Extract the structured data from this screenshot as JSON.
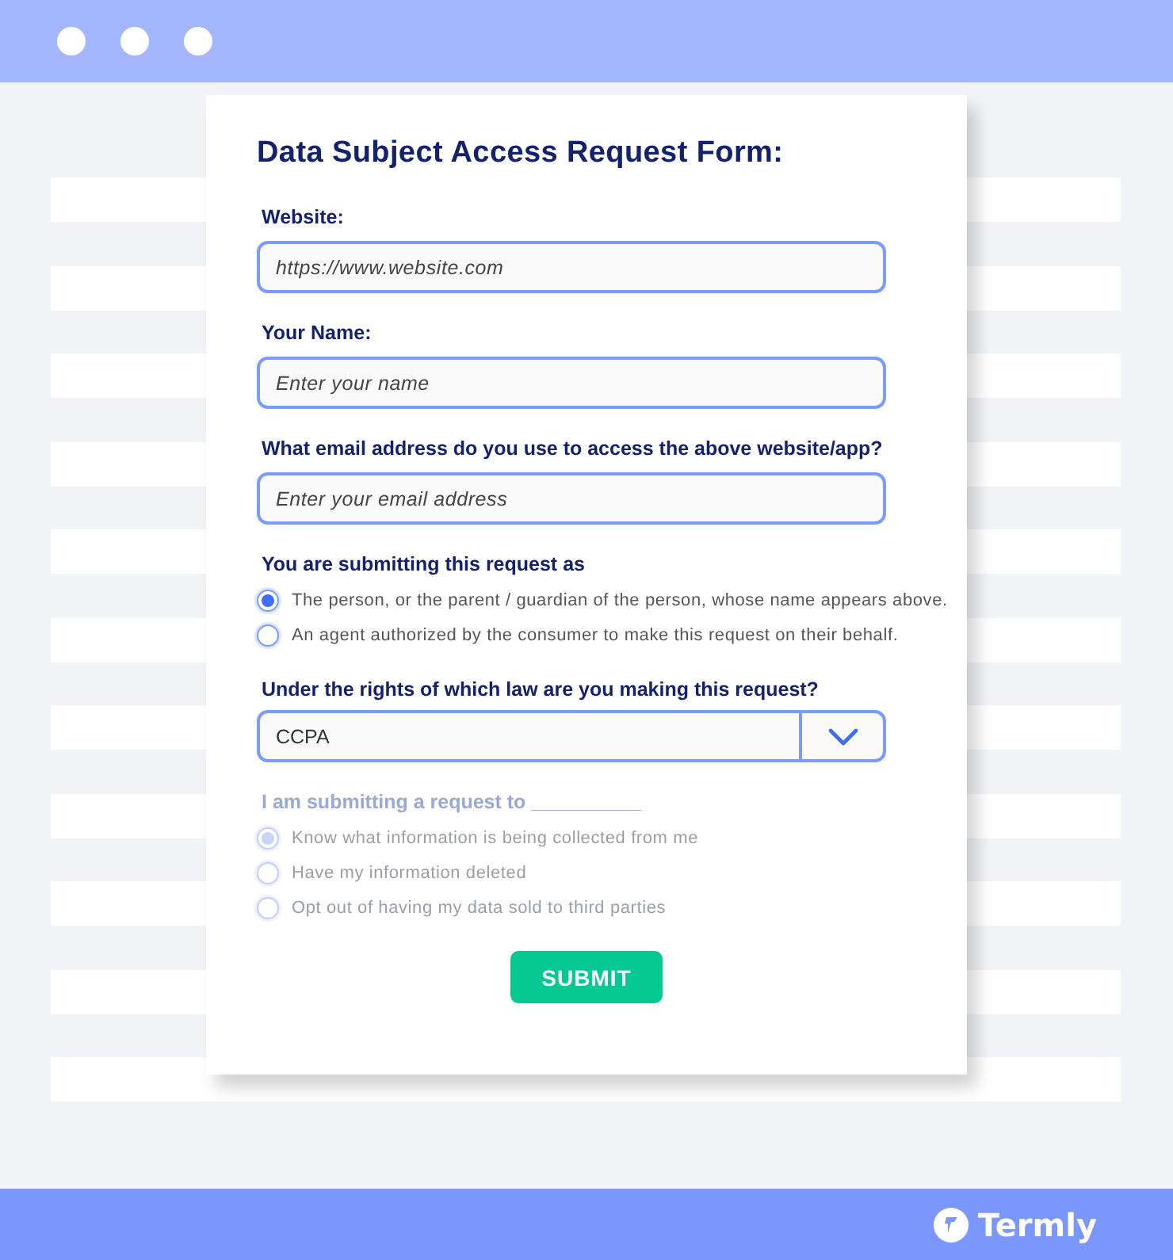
{
  "form": {
    "title": "Data Subject Access Request Form:",
    "fields": [
      {
        "label": "Website:",
        "placeholder": "https://www.website.com"
      },
      {
        "label": "Your Name:",
        "placeholder": "Enter your name"
      },
      {
        "label": "What email address do you use to access the above website/app?",
        "placeholder": "Enter your email address"
      }
    ],
    "request_as": {
      "label": "You are submitting this request as",
      "disabled": false,
      "options": [
        {
          "label": "The person, or the parent / guardian of the person, whose name appears above.",
          "selected": true
        },
        {
          "label": "An agent authorized by the consumer to make this request on their behalf.",
          "selected": false
        }
      ]
    },
    "law": {
      "label": "Under the rights of which law are you making this request?",
      "value": "CCPA"
    },
    "request_to": {
      "label": "I am submitting a request to __________",
      "disabled": true,
      "options": [
        {
          "label": "Know what information is being collected from me",
          "selected": true
        },
        {
          "label": "Have my information deleted",
          "selected": false
        },
        {
          "label": "Opt out of having my data sold to third parties",
          "selected": false
        }
      ]
    },
    "submit": "SUBMIT"
  },
  "footer": {
    "brand": "Termly"
  }
}
